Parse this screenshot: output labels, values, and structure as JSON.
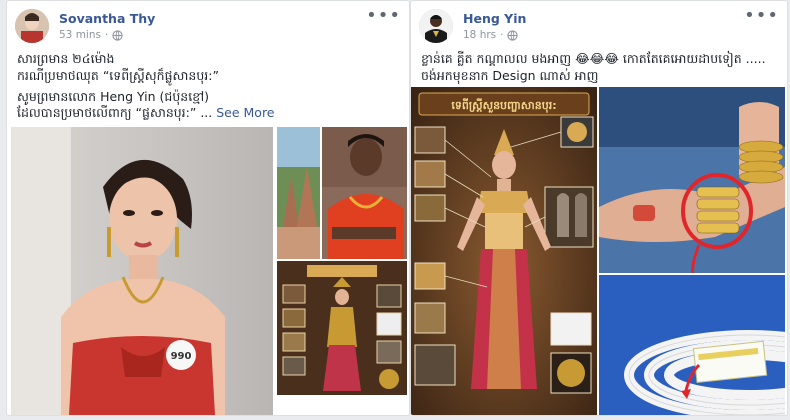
{
  "posts": [
    {
      "author": "Sovantha Thy",
      "time": "53 mins",
      "lines": [
        "សារព្រមាន ២៤ម៉ោង",
        "ករណីប្រមាថឈុត “ទេពីស្រ្តីសុក៏ផ្លូសានបុរ:”",
        "សូមព្រមានលោក Heng Yin (ជប៉ុនខ្មៅ)",
        "ដែលបានប្រមាថលើពាក្យ “ផ្លសានបុរ:” ..."
      ],
      "see_more": "See More",
      "badge_number": "990"
    },
    {
      "author": "Heng Yin",
      "time": "18 hrs",
      "lines": [
        "ខ្លាន់គេ គ្លីត កណ្ដាលល មងអាញ 😂😂😂 កោតតែគេអោយដាបទៀត .....",
        "ចង់អកមុខនាក Design ណាស់ អាញ"
      ],
      "poster_title": "ទេពីស្រ្តីសួនបញ្ចាសានបុរ:"
    }
  ],
  "icons": [
    "globe-icon",
    "more-options-icon"
  ],
  "colors": {
    "link": "#385898",
    "bg": "#e9ebee",
    "red_circle": "#e0262b"
  }
}
